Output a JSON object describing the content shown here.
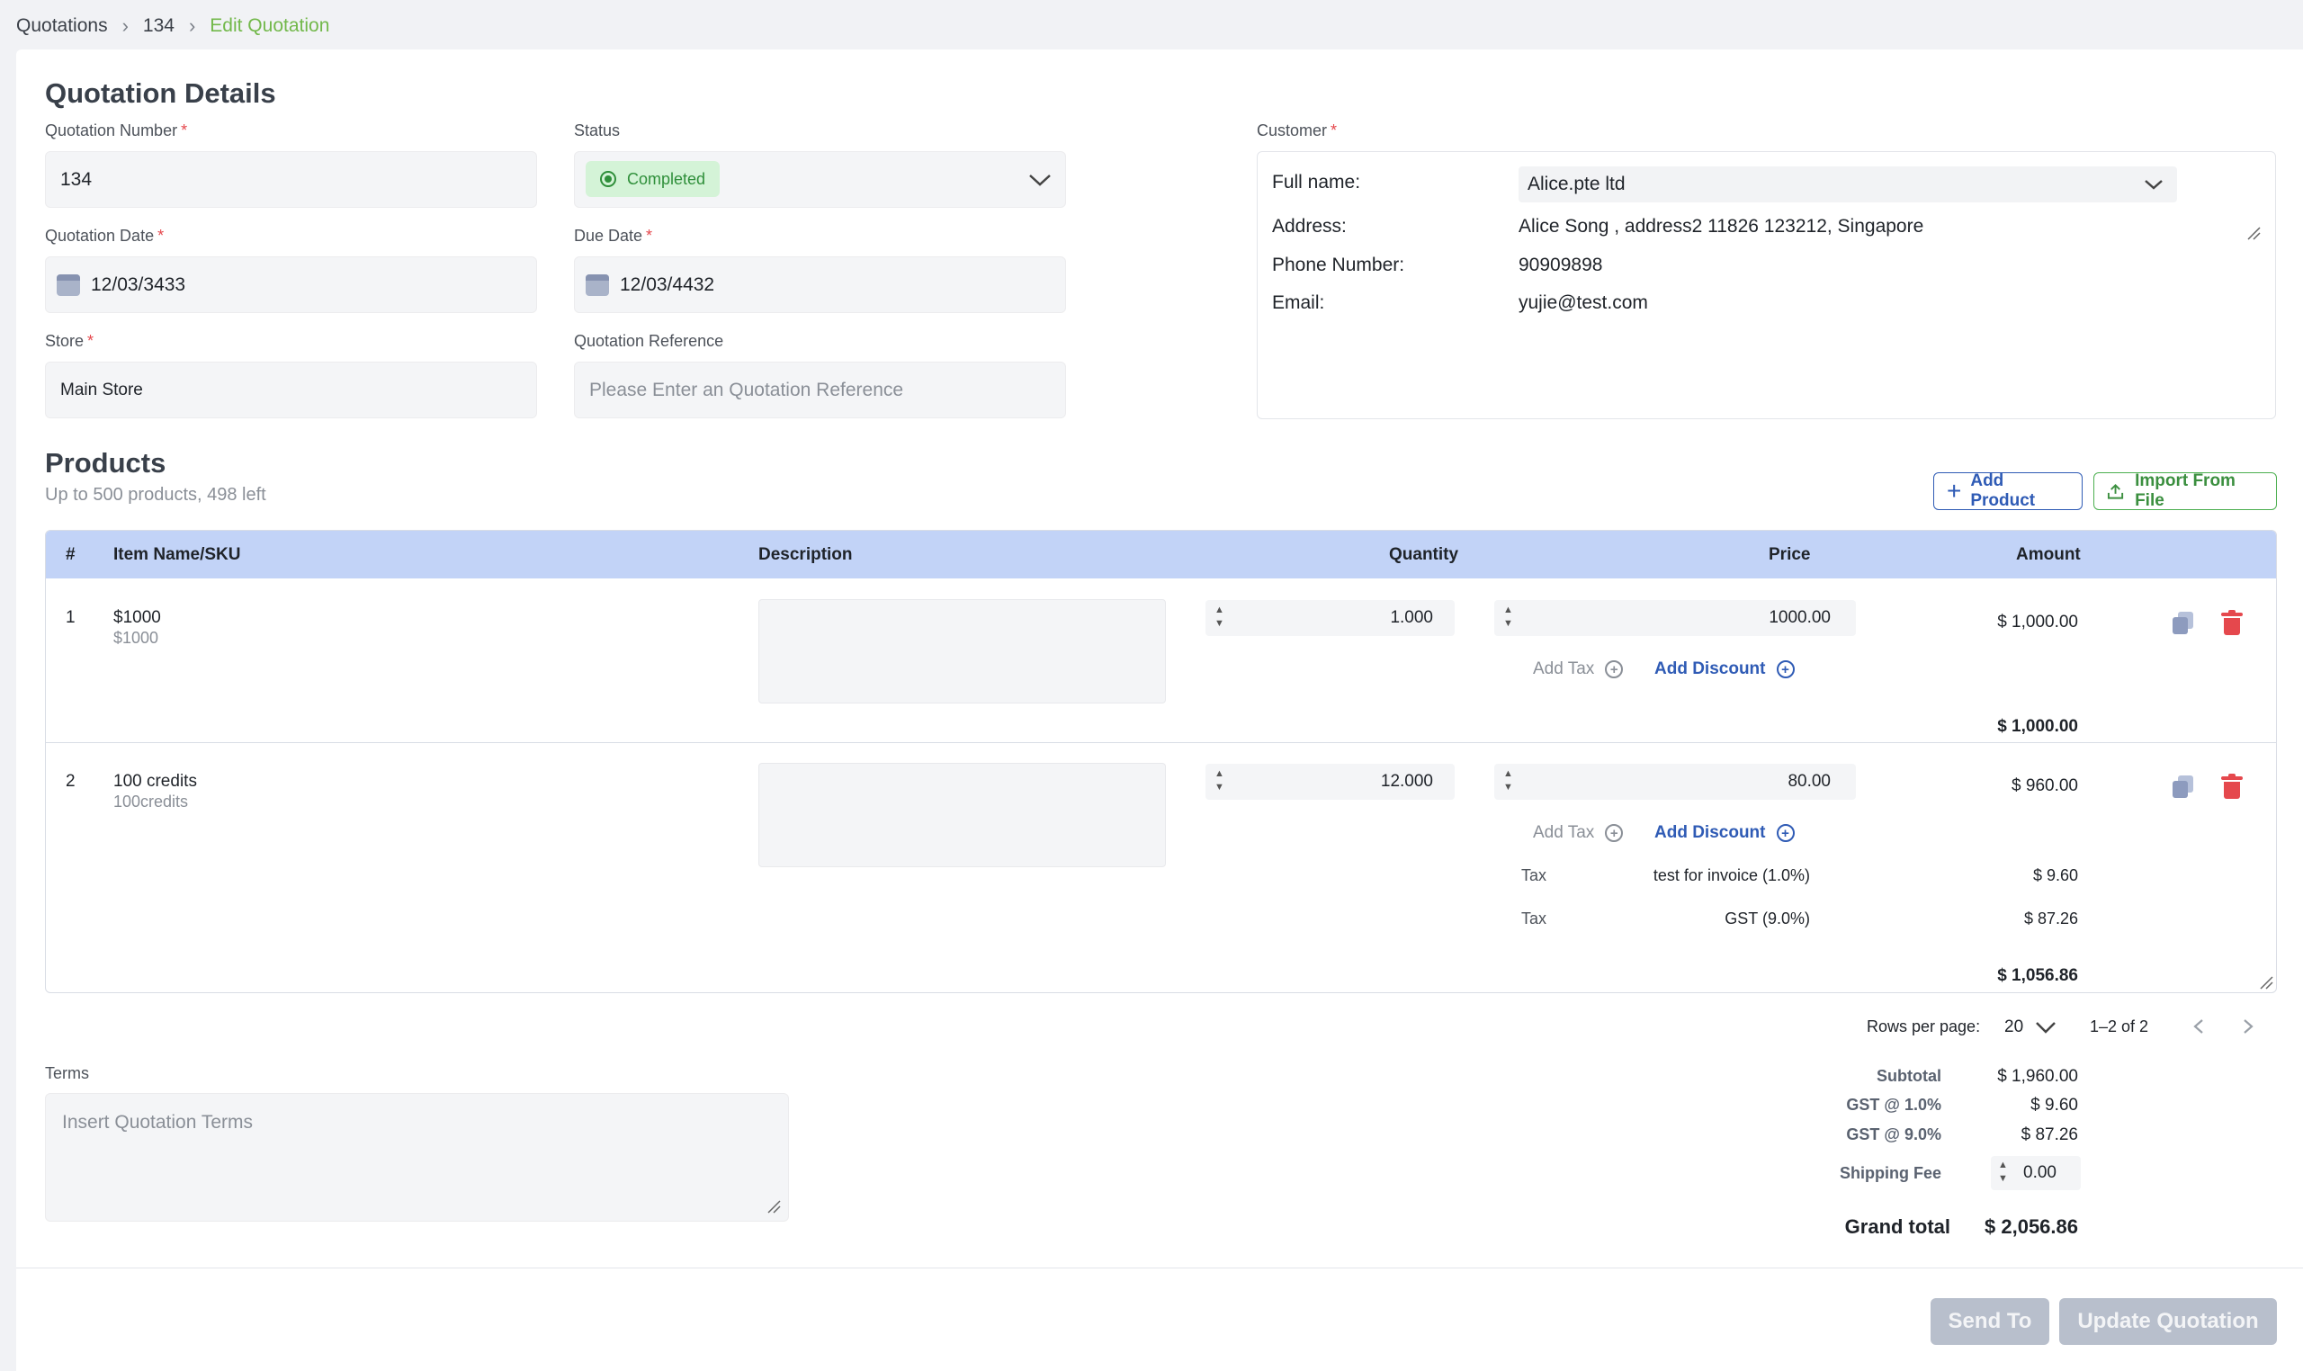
{
  "breadcrumb": {
    "items": [
      "Quotations",
      "134",
      "Edit Quotation"
    ]
  },
  "details": {
    "title": "Quotation Details",
    "quotation_number": {
      "label": "Quotation Number",
      "value": "134"
    },
    "status": {
      "label": "Status",
      "value": "Completed"
    },
    "quotation_date": {
      "label": "Quotation Date",
      "value": "12/03/3433"
    },
    "due_date": {
      "label": "Due Date",
      "value": "12/03/4432"
    },
    "store": {
      "label": "Store",
      "value": "Main Store"
    },
    "reference": {
      "label": "Quotation Reference",
      "placeholder": "Please Enter an Quotation Reference"
    },
    "customer": {
      "label": "Customer",
      "fullname_key": "Full name:",
      "fullname_value": "Alice.pte ltd",
      "address_key": "Address:",
      "address_value": "Alice Song , address2 11826 123212, Singapore",
      "phone_key": "Phone Number:",
      "phone_value": "90909898",
      "email_key": "Email:",
      "email_value": "yujie@test.com"
    }
  },
  "products": {
    "title": "Products",
    "subtitle": "Up to 500 products, 498 left",
    "add_product": "Add Product",
    "import_file": "Import From File",
    "headers": {
      "num": "#",
      "item": "Item Name/SKU",
      "desc": "Description",
      "qty": "Quantity",
      "price": "Price",
      "amount": "Amount"
    },
    "rows": [
      {
        "num": "1",
        "name": "$1000",
        "sku": "$1000",
        "qty": "1.000",
        "price": "1000.00",
        "amount": "$ 1,000.00",
        "add_tax": "Add Tax",
        "add_discount": "Add Discount",
        "total": "$ 1,000.00"
      },
      {
        "num": "2",
        "name": "100 credits",
        "sku": "100credits",
        "qty": "12.000",
        "price": "80.00",
        "amount": "$ 960.00",
        "add_tax": "Add Tax",
        "add_discount": "Add Discount",
        "taxes": [
          {
            "label": "Tax",
            "name": "test for invoice (1.0%)",
            "amount": "$ 9.60"
          },
          {
            "label": "Tax",
            "name": "GST (9.0%)",
            "amount": "$ 87.26"
          }
        ],
        "total": "$ 1,056.86"
      }
    ]
  },
  "pagination": {
    "rows_label": "Rows per page:",
    "rows_value": "20",
    "range": "1–2 of 2"
  },
  "terms": {
    "label": "Terms",
    "placeholder": "Insert Quotation Terms"
  },
  "summary": {
    "subtotal_label": "Subtotal",
    "subtotal": "$ 1,960.00",
    "gst1_label": "GST @ 1.0%",
    "gst1": "$ 9.60",
    "gst9_label": "GST @ 9.0%",
    "gst9": "$ 87.26",
    "shipping_label": "Shipping Fee",
    "shipping": "0.00",
    "grand_label": "Grand total",
    "grand": "$ 2,056.86"
  },
  "actions": {
    "send_to": "Send To",
    "update": "Update Quotation"
  },
  "colors": {
    "accent": "#2f5bb5",
    "success": "#72b84a",
    "table_header": "#c2d3f7",
    "danger": "#e5484d"
  }
}
